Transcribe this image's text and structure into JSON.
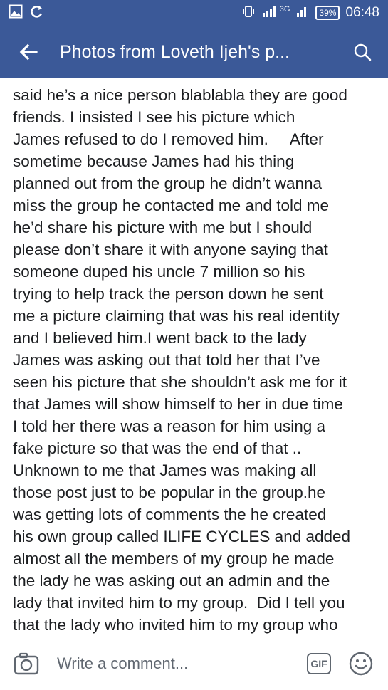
{
  "status_bar": {
    "network": "3G",
    "battery": "39%",
    "time": "06:48"
  },
  "app_bar": {
    "title": "Photos from Loveth Ijeh's p..."
  },
  "caption_lines": [
    "said he’s a nice person blablabla they are good",
    "friends. I insisted I see his picture which",
    "James refused to do I removed him.     After",
    "sometime because James had his thing",
    "planned out from the group he didn’t wanna",
    "miss the group he contacted me and told me",
    "he’d share his picture with me but I should",
    "please don’t share it with anyone saying that",
    "someone duped his uncle 7 million so his",
    "trying to help track the person down he sent",
    "me a picture claiming that was his real identity",
    "and I believed him.I went back to the lady",
    "James was asking out that told her that I’ve",
    "seen his picture that she shouldn’t ask me for it",
    "that James will show himself to her in due time",
    "I told her there was a reason for him using a",
    "fake picture so that was the end of that ..",
    "Unknown to me that James was making all",
    "those post just to be popular in the group.he",
    "was getting lots of comments the he created",
    "his own group called ILIFE CYCLES and added",
    "almost all the members of my group he made",
    "the lady he was asking out an admin and the",
    "lady that invited him to my group.  Did I tell you",
    "that the lady who invited him to my group who"
  ],
  "comment_bar": {
    "placeholder": "Write a comment...",
    "gif_label": "GIF"
  }
}
